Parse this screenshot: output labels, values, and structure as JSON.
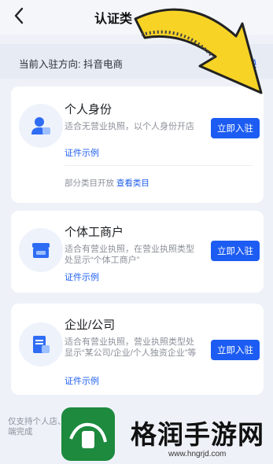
{
  "header": {
    "title": "认证类"
  },
  "direction": {
    "label": "当前入驻方向: 抖音电商",
    "switch_label": "换"
  },
  "cards": [
    {
      "title": "个人身份",
      "desc": "适合无营业执照，以个人身份开店",
      "link": "证件示例",
      "button": "立即入驻",
      "icon": "person-id-icon",
      "partial_text": "部分类目开放",
      "partial_link": "查看类目"
    },
    {
      "title": "个体工商户",
      "desc": "适合有营业执照，在营业执照类型处显示“个体工商户”",
      "link": "证件示例",
      "button": "立即入驻",
      "icon": "shop-icon"
    },
    {
      "title": "企业/公司",
      "desc": "适合有营业执照，营业执照类型处显示“某公司/企业/个人独资企业”等",
      "link": "证件示例",
      "button": "立即入驻",
      "icon": "company-document-icon"
    }
  ],
  "footer": {
    "note": "仅支持个人店、端完成"
  },
  "watermark": {
    "name": "格润手游网",
    "url": "www.hngrjd.com"
  },
  "colors": {
    "accent": "#1c5cf2",
    "background": "#eef2f8",
    "card": "#ffffff",
    "arrow": "#f7d326"
  }
}
